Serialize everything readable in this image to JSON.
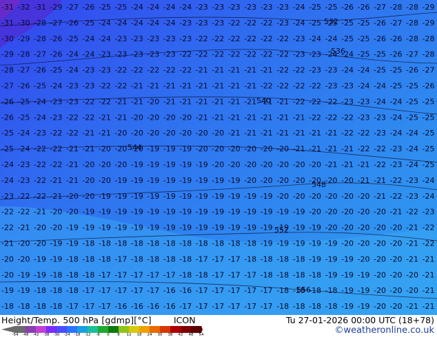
{
  "header": {
    "title": "Height/Temp. 500 hPa [gdmp][°C]",
    "model": "ICON",
    "valid": "Tu 27-01-2026 00:00 UTC (18+78)",
    "credit": "©weatheronline.co.uk"
  },
  "colorbar": {
    "ticks": [
      "-54",
      "-48",
      "-42",
      "-38",
      "-30",
      "-24",
      "-18",
      "-12",
      "-8",
      "0",
      "8",
      "12",
      "18",
      "24",
      "30",
      "38",
      "42",
      "48",
      "54"
    ],
    "colors": [
      "#6b6b6b",
      "#8a3fb0",
      "#c23fd6",
      "#7a2bff",
      "#4a4dff",
      "#2a74ff",
      "#1a9fe0",
      "#1bbf9a",
      "#1faa30",
      "#0f7a10",
      "#8fc41a",
      "#d6c910",
      "#f0a000",
      "#e86a00",
      "#d63a00",
      "#b00000",
      "#800000",
      "#5a0000"
    ]
  },
  "map": {
    "colors": {
      "cold": "#3a4ef5",
      "mid": "#2f78f0",
      "warm": "#2f9ef2",
      "warmest": "#5ab6f5",
      "contour": "#0a0a2a"
    },
    "contours": [
      "532",
      "536",
      "540",
      "544",
      "548",
      "552",
      "556"
    ],
    "rows": [
      "-31 -32 -31 -29 -27 -26 -25 -25 -24 -24 -24 -24 -23 -23 -23 -23 -23 -23 -24 -25 -25 -26 -26 -27 -28 -28 -29",
      "-31 -30 -28 -27 -26 -25 -24 -24 -24 -24 -24 -23 -23 -23 -22 -22 -22 -23 -24 -25 -25 -25 -25 -26 -27 -28 -29",
      "-30 -29 -28 -26 -25 -24 -24 -23 -23 -23 -23 -23 -22 -22 -22 -22 -22 -22 -23 -24 -24 -25 -25 -26 -26 -28 -28",
      "-29 -28 -27 -26 -24 -24 -23 -23 -23 -23 -23 -22 -22 -22 -22 -22 -22 -22 -23 -23 -24 -24 -25 -25 -26 -27 -28",
      "-28 -27 -26 -25 -24 -23 -23 -22 -22 -22 -22 -22 -21 -21 -21 -21 -21 -22 -22 -23 -23 -24 -24 -25 -25 -26 -27",
      "-27 -26 -25 -24 -23 -23 -22 -22 -21 -21 -21 -21 -21 -21 -21 -21 -22 -22 -22 -22 -23 -23 -24 -24 -25 -25 -26",
      "-26 -25 -24 -23 -23 -22 -22 -21 -21 -20 -21 -21 -21 -21 -21 -21 -21 -21 -22 -22 -22 -23 -23 -24 -24 -25 -25",
      "-26 -25 -24 -23 -22 -22 -21 -21 -20 -20 -20 -20 -21 -21 -21 -21 -21 -21 -21 -22 -22 -22 -23 -23 -24 -25 -25",
      "-25 -24 -23 -22 -22 -21 -21 -20 -20 -20 -20 -20 -20 -20 -21 -21 -21 -21 -21 -21 -21 -22 -22 -23 -24 -24 -25",
      "-25 -24 -22 -22 -21 -21 -20 -20 -20 -19 -19 -19 -20 -20 -20 -20 -20 -20 -21 -21 -21 -21 -22 -22 -23 -24 -25",
      "-24 -23 -22 -22 -21 -20 -20 -20 -19 -19 -19 -19 -19 -20 -20 -20 -20 -20 -20 -20 -21 -21 -21 -22 -23 -24 -25",
      "-24 -23 -22 -21 -21 -20 -20 -19 -19 -19 -19 -19 -19 -19 -19 -20 -20 -20 -20 -20 -20 -20 -21 -21 -22 -23 -24",
      "-23 -22 -22 -21 -20 -20 -19 -19 -19 -19 -19 -19 -19 -19 -19 -19 -19 -20 -20 -20 -20 -20 -20 -21 -22 -23 -24",
      "-22 -22 -21 -20 -20 -19 -19 -19 -19 -19 -19 -19 -19 -19 -19 -19 -19 -19 -19 -20 -20 -20 -20 -20 -21 -22 -23",
      "-22 -21 -20 -20 -19 -19 -19 -19 -19 -19 -19 -19 -19 -19 -19 -19 -19 -19 -19 -19 -20 -20 -20 -20 -20 -21 -22",
      "-21 -20 -20 -19 -19 -18 -18 -18 -18 -18 -18 -18 -18 -18 -18 -18 -19 -19 -19 -19 -19 -20 -20 -20 -20 -21 -22",
      "-20 -20 -19 -19 -18 -18 -18 -17 -18 -18 -18 -18 -17 -17 -17 -18 -18 -18 -18 -19 -19 -19 -20 -20 -20 -21 -21",
      "-20 -19 -19 -18 -18 -18 -17 -17 -17 -17 -17 -18 -18 -17 -17 -17 -18 -18 -18 -18 -19 -19 -19 -20 -20 -20 -21",
      "-19 -19 -18 -18 -18 -17 -17 -17 -17 -17 -16 -16 -17 -17 -17 -17 -17 -18 -18 -18 -18 -19 -19 -20 -20 -20 -21",
      "-18 -18 -18 -18 -17 -17 -17 -16 -16 -16 -16 -17 -17 -17 -17 -17 -17 -18 -18 -18 -18 -19 -19 -20 -20 -21 -21"
    ]
  }
}
